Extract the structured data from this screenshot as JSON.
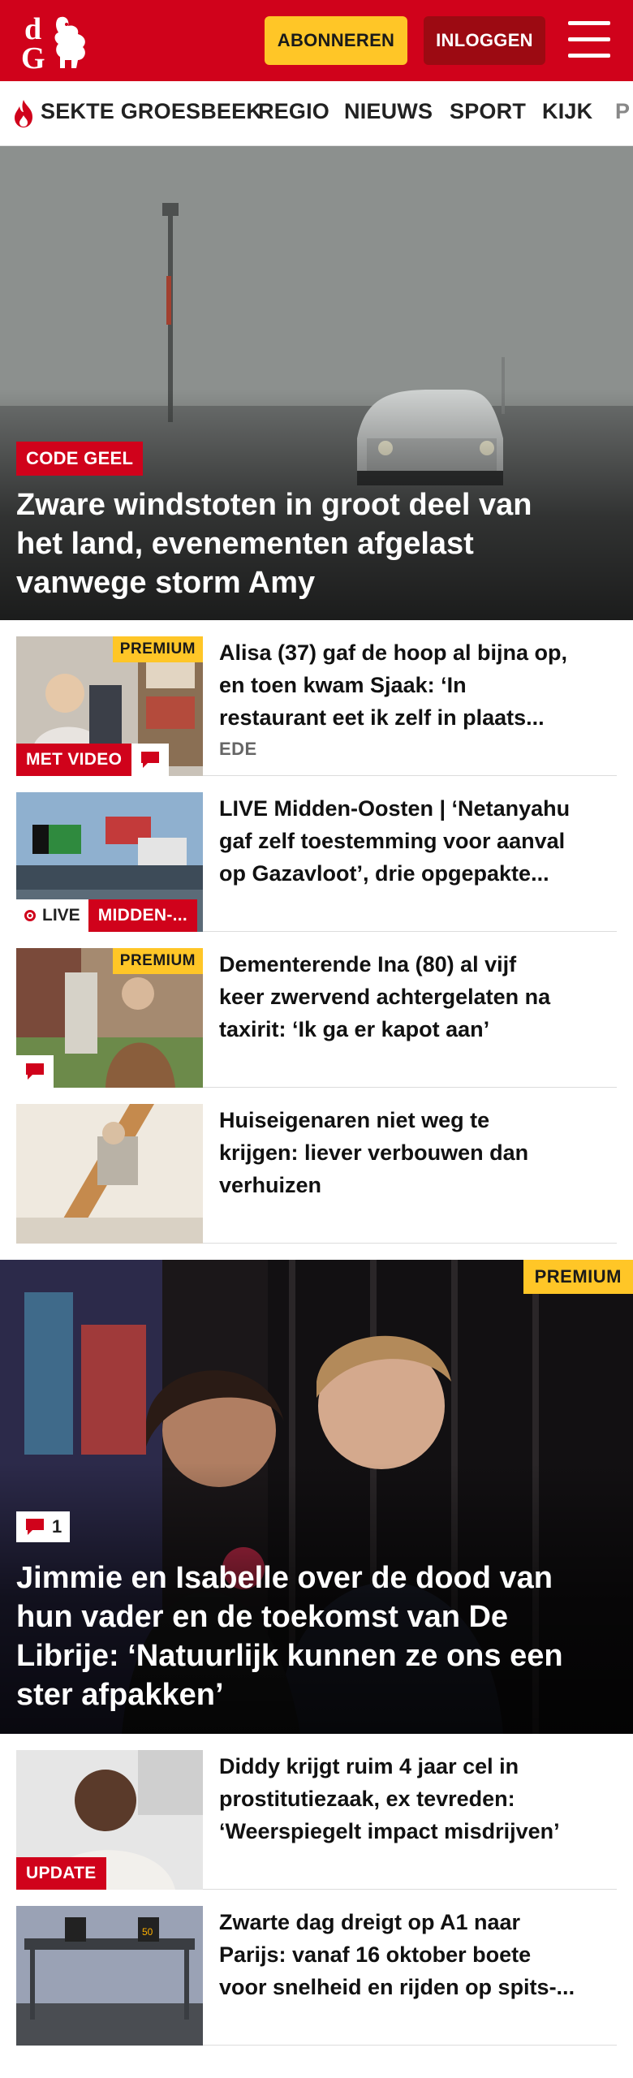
{
  "header": {
    "subscribe_label": "ABONNEREN",
    "login_label": "INLOGGEN"
  },
  "nav": {
    "items": [
      "SEKTE GROESBEEK",
      "REGIO",
      "NIEUWS",
      "SPORT",
      "KIJK",
      "P"
    ]
  },
  "hero": {
    "tag": "CODE GEEL",
    "title_lines": [
      "Zware windstoten in groot deel van",
      "het land, evenementen afgelast",
      "vanwege storm Amy"
    ]
  },
  "articles": [
    {
      "premium": "PREMIUM",
      "badge": "MET VIDEO",
      "title_lines": [
        "Alisa (37) gaf de hoop al bijna op,",
        "en toen kwam Sjaak: ‘In",
        "restaurant eet ik zelf in plaats..."
      ],
      "meta": "EDE"
    },
    {
      "live": "LIVE",
      "badge": "MIDDEN-...",
      "title_lines": [
        "LIVE Midden-Oosten | ‘Netanyahu",
        "gaf zelf toestemming voor aanval",
        "op Gazavloot’, drie opgepakte..."
      ]
    },
    {
      "premium": "PREMIUM",
      "title_lines": [
        "Dementerende Ina (80) al vijf",
        "keer zwervend achtergelaten na",
        "taxirit: ‘Ik ga er kapot aan’"
      ]
    },
    {
      "title_lines": [
        "Huiseigenaren niet weg te",
        "krijgen: liever verbouwen dan",
        "verhuizen"
      ]
    }
  ],
  "feature": {
    "premium": "PREMIUM",
    "comment_count": "1",
    "title_lines": [
      "Jimmie en Isabelle over de dood van",
      "hun vader en de toekomst van De",
      "Librije: ‘Natuurlijk kunnen ze ons een",
      "ster afpakken’"
    ]
  },
  "articles2": [
    {
      "badge": "UPDATE",
      "title_lines": [
        "Diddy krijgt ruim 4 jaar cel in",
        "prostitutiezaak, ex tevreden:",
        "‘Weerspiegelt impact misdrijven’"
      ]
    },
    {
      "title_lines": [
        "Zwarte dag dreigt op A1 naar",
        "Parijs: vanaf 16 oktober boete",
        "voor snelheid en rijden op spits-..."
      ]
    }
  ],
  "colors": {
    "brand_red": "#d0021b",
    "premium_yellow": "#ffc627",
    "login_dark_red": "#9c0a12"
  }
}
